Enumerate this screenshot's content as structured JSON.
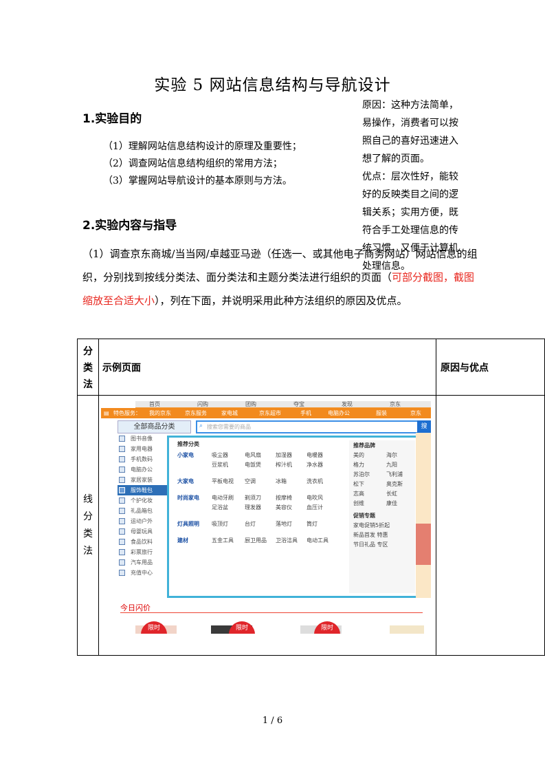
{
  "title": "实验 5  网站信息结构与导航设计",
  "section1": {
    "heading": "1.实验目的",
    "items": [
      "（1）理解网站信息结构设计的原理及重要性；",
      "（2）调查网站信息结构组织的常用方法；",
      "（3）掌握网站导航设计的基本原则与方法。"
    ]
  },
  "section2": {
    "heading": "2.实验内容与指导",
    "para_part1": "（1）调查京东商城/当当网/卓越亚马逊（任选一、或其他电子商务网站）网站信息的组织，分别找到按线分类法、面分类法和主题分类法进行组织的页面（",
    "para_red": "可部分截图，截图缩放至合适大小",
    "para_part2": "），列在下面，并说明采用此种方法组织的原因及优点。"
  },
  "table": {
    "col1_header": [
      "分",
      "类",
      "法"
    ],
    "col2_header": "示例页面",
    "col3_header": "原因与优点",
    "row_label": [
      "线",
      "分",
      "类",
      "法"
    ],
    "reason_text": "原因：这种方法简单，易操作，消费者可以按照自己的喜好迅速进入想了解的页面。",
    "advantage_text": "优点：层次性好，能较好的反映类目之间的逻辑关系；实用方便，既符合手工处理信息的传统习惯，又便于计算机处理信息。"
  },
  "screenshot": {
    "top_tabs": [
      "首页",
      "闪购",
      "团购",
      "夺宝",
      "发现",
      "京东"
    ],
    "orange_bar": [
      "特色服务：",
      "我的京东",
      "京东服务",
      "家电城",
      "京东超市",
      "手机",
      "电脑办公",
      "服装",
      "京东"
    ],
    "all_categories": "全部商品分类",
    "search_placeholder": "搜索您需要的商品",
    "search_button": "搜",
    "categories": [
      "图书音像",
      "家用电器",
      "手机数码",
      "电脑办公",
      "家居家装",
      "服饰鞋包",
      "个护化妆",
      "礼品箱包",
      "运动户外",
      "母婴玩具",
      "食品饮料",
      "彩票旅行",
      "汽车用品",
      "充值中心"
    ],
    "popup_title": "推荐分类",
    "popup_rows": [
      {
        "cat": "小家电",
        "items": [
          "吸尘器",
          "电风扇",
          "加湿器",
          "电暖器",
          "豆浆机",
          "电饭煲",
          "榨汁机",
          "净水器"
        ]
      },
      {
        "cat": "大家电",
        "items": [
          "平板电视",
          "空调",
          "冰箱",
          "洗衣机"
        ]
      },
      {
        "cat": "时尚家电",
        "items": [
          "电动牙刷",
          "剃须刀",
          "按摩椅",
          "电吹风",
          "足浴盆",
          "理发器",
          "美容仪",
          "血压计"
        ]
      },
      {
        "cat": "灯具照明",
        "items": [
          "吸顶灯",
          "台灯",
          "落地灯",
          "筒灯"
        ]
      },
      {
        "cat": "建材",
        "items": [
          "五金工具",
          "厨卫用品",
          "卫浴洁具",
          "电动工具"
        ]
      }
    ],
    "brand_title": "推荐品牌",
    "brands": [
      "美的",
      "海尔",
      "格力",
      "九阳",
      "苏泊尔",
      "飞利浦",
      "松下",
      "奥克斯",
      "志高",
      "长虹",
      "创维",
      "康佳"
    ],
    "brand_title2": "促销专题",
    "promos": [
      "家电促销5折起",
      "新品首发 特惠",
      "节日礼品 专区"
    ],
    "flash_title": "今日闪价",
    "badges": [
      "限时",
      "限时",
      "限时"
    ]
  },
  "footer": "1 / 6"
}
